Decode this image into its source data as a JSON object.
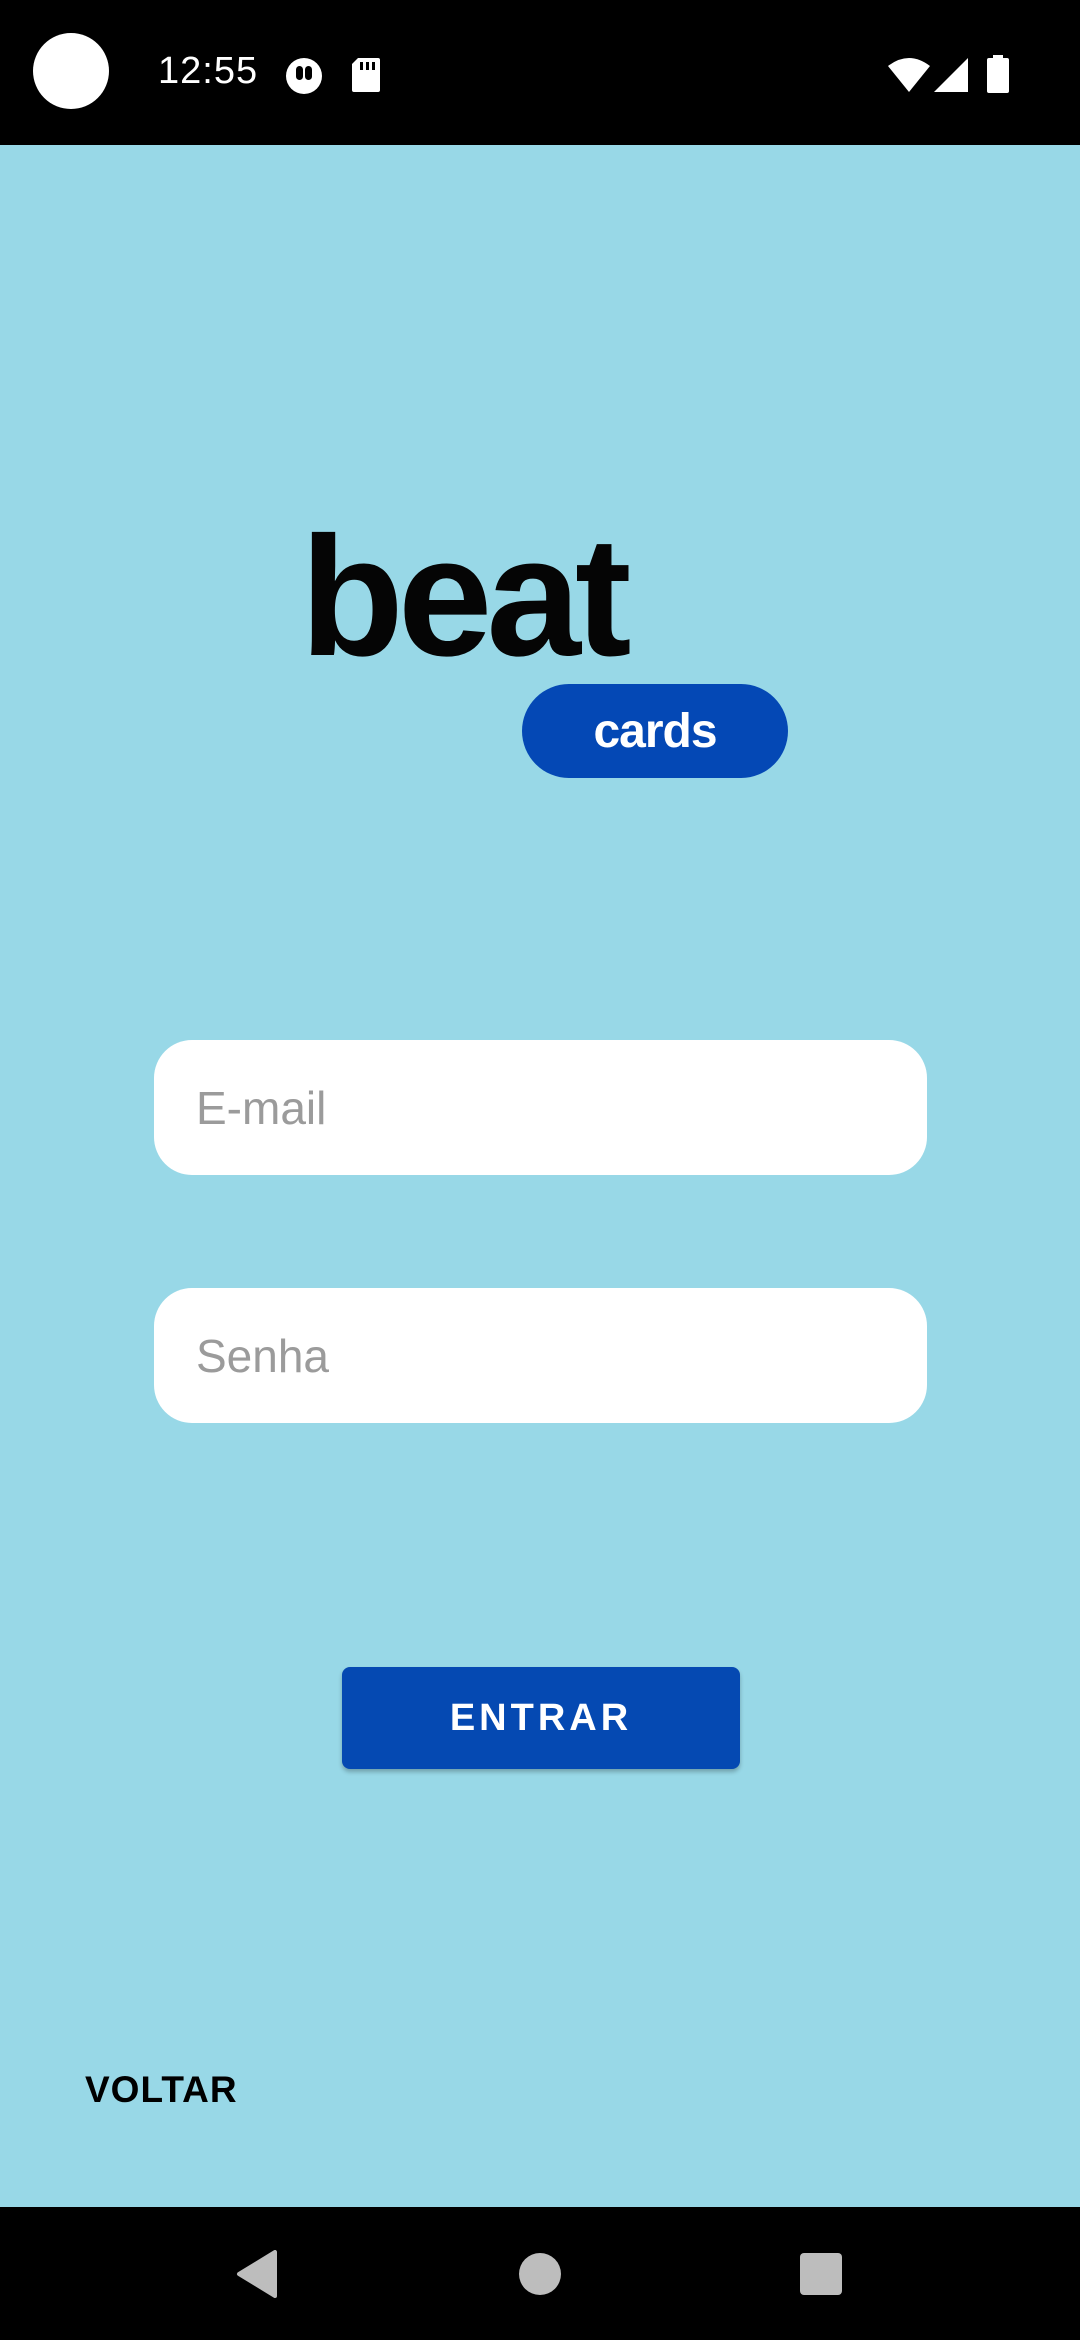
{
  "status_bar": {
    "time": "12:55",
    "left_icons": [
      "record-icon",
      "sd-card-icon"
    ],
    "right_icons": [
      "wifi-icon",
      "signal-icon",
      "battery-icon"
    ]
  },
  "logo": {
    "word": "beat",
    "badge": "cards",
    "brand_color": "#0448b5"
  },
  "form": {
    "email_placeholder": "E-mail",
    "email_value": "",
    "password_placeholder": "Senha",
    "password_value": "",
    "submit_label": "ENTRAR"
  },
  "back_label": "VOLTAR",
  "nav": {
    "items": [
      "back-icon",
      "home-icon",
      "recents-icon"
    ]
  },
  "colors": {
    "background": "#98d8e7",
    "button": "#0549b2"
  }
}
